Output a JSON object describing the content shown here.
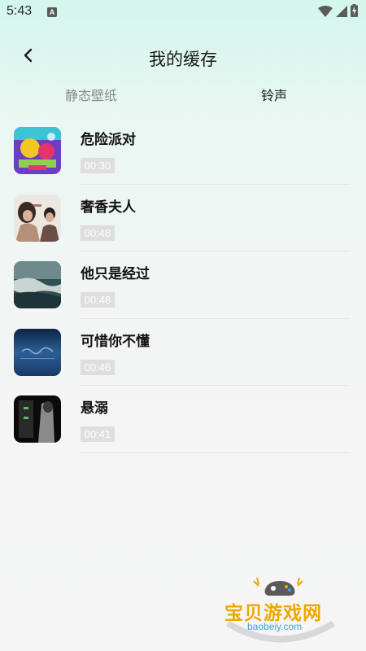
{
  "status_bar": {
    "time": "5:43",
    "notification_icon": "A"
  },
  "header": {
    "back_icon": "chevron-left-icon",
    "title": "我的缓存"
  },
  "tabs": [
    {
      "label": "静态壁纸",
      "active": false
    },
    {
      "label": "铃声",
      "active": true
    }
  ],
  "items": [
    {
      "title": "危险派对",
      "duration": "00:30",
      "thumb_colors": [
        "#6b3fbf",
        "#e5356f",
        "#f3c623",
        "#3cc3d6"
      ]
    },
    {
      "title": "奢香夫人",
      "duration": "00:48",
      "thumb_colors": [
        "#e8e4df",
        "#3a2a26",
        "#b59079",
        "#6a4f44"
      ]
    },
    {
      "title": "他只是经过",
      "duration": "00:48",
      "thumb_colors": [
        "#2f4f55",
        "#7e979a",
        "#c8d4d2",
        "#1f3438"
      ]
    },
    {
      "title": "可惜你不懂",
      "duration": "00:46",
      "thumb_colors": [
        "#173a66",
        "#2c5f95",
        "#8fb3d6",
        "#0d2444"
      ]
    },
    {
      "title": "悬溺",
      "duration": "00:41",
      "thumb_colors": [
        "#0a0a0a",
        "#2a2a2a",
        "#5bbf5f",
        "#8a8a8a"
      ]
    }
  ],
  "watermark": {
    "name": "宝贝游戏网",
    "domain": "baobeiy.com"
  }
}
